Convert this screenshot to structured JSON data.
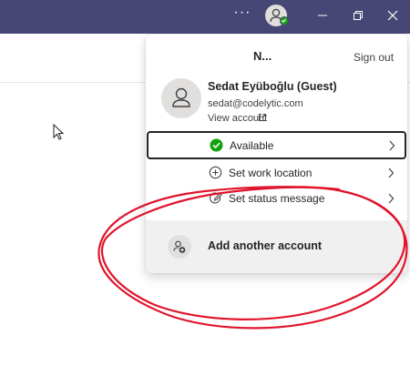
{
  "titlebar": {
    "more_label": "···",
    "avatar_icon": "person-icon",
    "presence_color": "#13a10e",
    "background": "#464775",
    "window_buttons": [
      "minimize-icon",
      "restore-icon",
      "close-icon"
    ]
  },
  "flyout": {
    "org_name": "N...",
    "sign_out": "Sign out",
    "profile": {
      "name": "Sedat Eyüboğlu (Guest)",
      "email": "sedat@codelytic.com",
      "view_account": "View account"
    },
    "status_items": [
      {
        "label": "Available",
        "icon": "available-check-icon",
        "icon_color": "#13a10e"
      },
      {
        "label": "Set work location",
        "icon": "location-plus-icon"
      },
      {
        "label": "Set status message",
        "icon": "status-message-edit-icon"
      }
    ],
    "add_account": "Add another account"
  },
  "annotation": {
    "color": "#e0142b",
    "shape": "hand-drawn-ellipse"
  }
}
